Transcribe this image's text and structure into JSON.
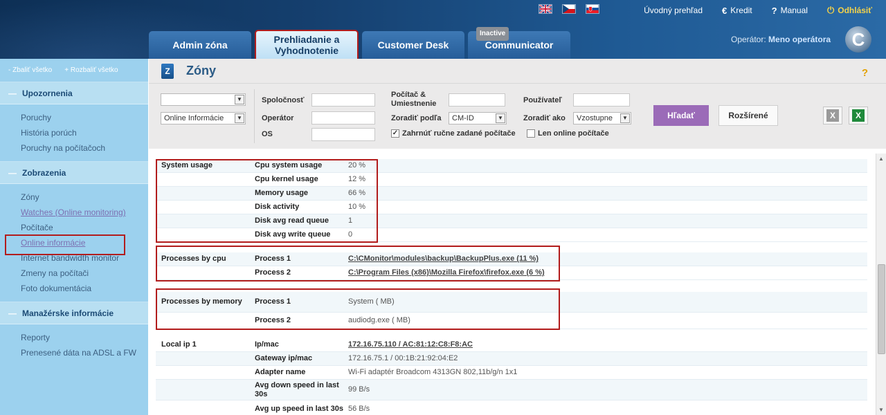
{
  "header": {
    "flags": [
      "flag-uk-icon",
      "flag-cz-icon",
      "flag-sk-icon"
    ],
    "nav": {
      "overview": "Úvodný prehľad",
      "credit": "Kredit",
      "manual": "Manual",
      "logout": "Odhlásiť"
    },
    "tabs": [
      {
        "label": "Admin zóna"
      },
      {
        "label": "Prehliadanie a Vyhodnotenie"
      },
      {
        "label": "Customer Desk"
      },
      {
        "label": "Communicator",
        "badge": "Inactive"
      }
    ],
    "operator_label": "Operátor:",
    "operator_name": "Meno operátora"
  },
  "sidebar": {
    "collapse_all": "Zbaliť všetko",
    "expand_all": "Rozbaliť všetko",
    "sections": [
      {
        "title": "Upozornenia",
        "items": [
          "Poruchy",
          "História porúch",
          "Poruchy na počítačoch"
        ]
      },
      {
        "title": "Zobrazenia",
        "items": [
          "Zóny",
          "Watches (Online monitoring)",
          "Počítače",
          "Online informácie",
          "Internet bandwidth monitor",
          "Zmeny na počítači",
          "Foto dokumentácia"
        ]
      },
      {
        "title": "Manažérske informácie",
        "items": [
          "Reporty",
          "Prenesené dáta na ADSL a FW"
        ]
      }
    ]
  },
  "page": {
    "title": "Zóny",
    "help": "?"
  },
  "filter": {
    "select1": "",
    "select2": "Online Informácie",
    "company_label": "Spoločnosť",
    "operator_label": "Operátor",
    "os_label": "OS",
    "computer_label": "Počítač & Umiestnenie",
    "sort_by_label": "Zoradiť podľa",
    "sort_by_value": "CM-ID",
    "user_label": "Používateľ",
    "sort_as_label": "Zoradiť ako",
    "sort_as_value": "Vzostupne",
    "include_manual": "Zahrnúť ručne zadané počítače",
    "online_only": "Len online počítače",
    "search_button": "Hľadať",
    "advanced_button": "Rozšírené"
  },
  "rows": [
    {
      "group": "System usage",
      "key": "Cpu system usage",
      "value": "20 %"
    },
    {
      "group": "",
      "key": "Cpu kernel usage",
      "value": "12 %"
    },
    {
      "group": "",
      "key": "Memory usage",
      "value": "66 %"
    },
    {
      "group": "",
      "key": "Disk activity",
      "value": "10 %"
    },
    {
      "group": "",
      "key": "Disk avg read queue",
      "value": "1"
    },
    {
      "group": "",
      "key": "Disk avg write queue",
      "value": "0"
    },
    {
      "group": "Processes by cpu",
      "key": "Process 1",
      "value": "C:\\CMonitor\\modules\\backup\\BackupPlus.exe (11 %)"
    },
    {
      "group": "",
      "key": "Process 2",
      "value": "C:\\Program Files (x86)\\Mozilla Firefox\\firefox.exe (6 %)"
    },
    {
      "group": "Processes by memory",
      "key": "Process 1",
      "value": "System ( MB)"
    },
    {
      "group": "",
      "key": "Process 2",
      "value": "audiodg.exe ( MB)"
    },
    {
      "group": "Local ip 1",
      "key": "Ip/mac",
      "value": "172.16.75.110 / AC:81:12:C8:F8:AC"
    },
    {
      "group": "",
      "key": "Gateway ip/mac",
      "value": "172.16.75.1 / 00:1B:21:92:04:E2"
    },
    {
      "group": "",
      "key": "Adapter name",
      "value": "Wi-Fi adaptér Broadcom 4313GN 802,11b/g/n 1x1"
    },
    {
      "group": "",
      "key": "Avg down speed in last 30s",
      "value": "99 B/s"
    },
    {
      "group": "",
      "key": "Avg up speed in last 30s",
      "value": "56 B/s"
    }
  ]
}
